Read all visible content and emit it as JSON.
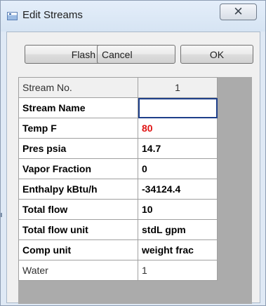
{
  "window": {
    "title": "Edit Streams",
    "close_glyph": "✕"
  },
  "buttons": {
    "flash": "Flash",
    "cancel": "Cancel",
    "ok": "OK"
  },
  "grid": {
    "header": {
      "label": "Stream No.",
      "value": "1"
    },
    "rows": [
      {
        "label": "Stream Name",
        "value": ""
      },
      {
        "label": "Temp  F",
        "value": "80",
        "value_color": "#e01414"
      },
      {
        "label": "Pres  psia",
        "value": "14.7"
      },
      {
        "label": "Vapor Fraction",
        "value": "0"
      },
      {
        "label": "Enthalpy kBtu/h",
        "value": "-34124.4"
      },
      {
        "label": "Total flow",
        "value": "10"
      },
      {
        "label": "Total flow unit",
        "value": "stdL gpm"
      },
      {
        "label": "Comp unit",
        "value": "weight frac"
      },
      {
        "label": "Water",
        "value": "1"
      }
    ]
  },
  "icons": {
    "title": "window-icon",
    "close": "close-icon"
  }
}
